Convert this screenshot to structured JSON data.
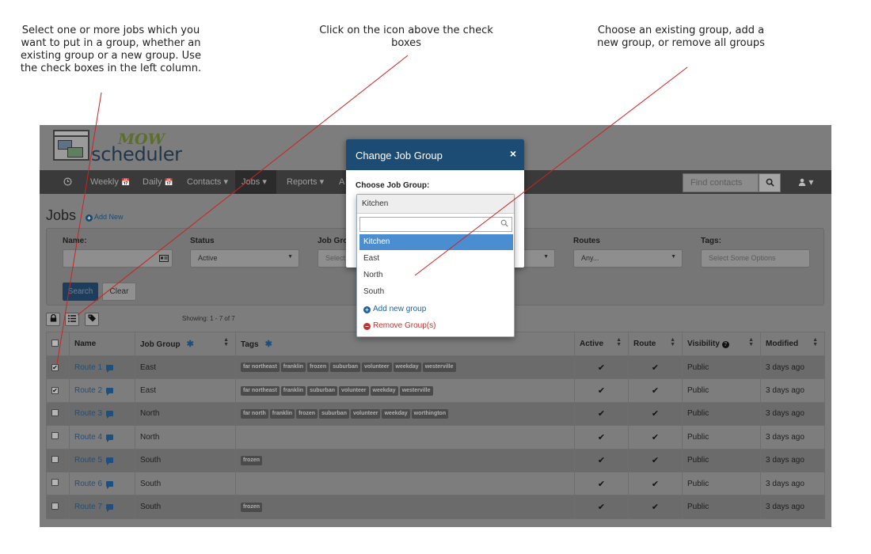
{
  "annotations": [
    "Select one or more jobs which you want to put in a group, whether an existing group or a new group. Use the check boxes in the left column.",
    "Click on the icon above the check boxes",
    "Choose an existing group, add a new group, or remove all groups"
  ],
  "logo": {
    "mow": "MOW",
    "scheduler": "scheduler"
  },
  "nav": {
    "clock_icon": "clock-icon",
    "weekly": "Weekly",
    "daily": "Daily",
    "contacts": "Contacts",
    "jobs": "Jobs",
    "reports": "Reports",
    "truncated": "A",
    "search_placeholder": "Find contacts",
    "calendar_glyph": "📅",
    "caret": "▾"
  },
  "page": {
    "title": "Jobs",
    "add_new": "Add New"
  },
  "filters": {
    "name_label": "Name:",
    "status_label": "Status",
    "status_value": "Active",
    "job_group_label": "Job Gro",
    "job_group_placeholder": "Select S",
    "routes_label": "Routes",
    "routes_value": "Any...",
    "tags_label": "Tags:",
    "tags_placeholder": "Select Some Options",
    "search_button": "Search",
    "clear_button": "Clear"
  },
  "toolbar": {
    "showing": "Showing: 1 - 7 of 7"
  },
  "table": {
    "headers": {
      "name": "Name",
      "job_group": "Job Group",
      "tags": "Tags",
      "active": "Active",
      "route": "Route",
      "visibility": "Visibility",
      "modified": "Modified"
    },
    "rows": [
      {
        "checked": true,
        "name": "Route 1",
        "group": "East",
        "tags": [
          "far northeast",
          "franklin",
          "frozen",
          "suburban",
          "volunteer",
          "weekday",
          "westerville"
        ],
        "active": "✔",
        "route": "✔",
        "visibility": "Public",
        "modified": "3 days ago"
      },
      {
        "checked": true,
        "name": "Route 2",
        "group": "East",
        "tags": [
          "far northeast",
          "franklin",
          "suburban",
          "volunteer",
          "weekday",
          "westerville"
        ],
        "active": "✔",
        "route": "✔",
        "visibility": "Public",
        "modified": "3 days ago"
      },
      {
        "checked": false,
        "name": "Route 3",
        "group": "North",
        "tags": [
          "far north",
          "franklin",
          "frozen",
          "suburban",
          "volunteer",
          "weekday",
          "worthington"
        ],
        "active": "✔",
        "route": "✔",
        "visibility": "Public",
        "modified": "3 days ago"
      },
      {
        "checked": false,
        "name": "Route 4",
        "group": "North",
        "tags": [],
        "active": "✔",
        "route": "✔",
        "visibility": "Public",
        "modified": "3 days ago"
      },
      {
        "checked": false,
        "name": "Route 5",
        "group": "South",
        "tags": [
          "frozen"
        ],
        "active": "✔",
        "route": "✔",
        "visibility": "Public",
        "modified": "3 days ago"
      },
      {
        "checked": false,
        "name": "Route 6",
        "group": "South",
        "tags": [],
        "active": "✔",
        "route": "✔",
        "visibility": "Public",
        "modified": "3 days ago"
      },
      {
        "checked": false,
        "name": "Route 7",
        "group": "South",
        "tags": [
          "frozen"
        ],
        "active": "✔",
        "route": "✔",
        "visibility": "Public",
        "modified": "3 days ago"
      }
    ]
  },
  "modal": {
    "title": "Change Job Group",
    "close": "×",
    "label": "Choose Job Group:",
    "selected": "Kitchen",
    "options": [
      "Kitchen",
      "East",
      "North",
      "South"
    ],
    "add_new_group": "Add new group",
    "remove_groups": "Remove Group(s)"
  },
  "colors": {
    "annotation_line": "#cc2222",
    "modal_header": "#1c4b74",
    "highlight": "#4a8ed1",
    "remove": "#c9302c"
  }
}
